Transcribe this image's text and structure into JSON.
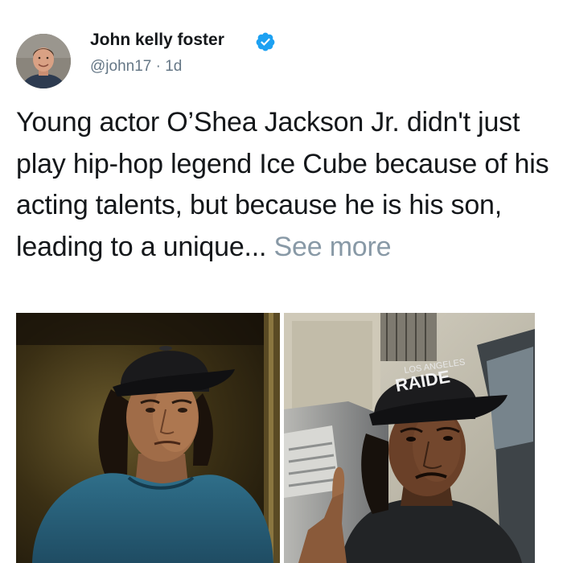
{
  "tweet": {
    "author": {
      "name": "John kelly foster",
      "handle": "@john17",
      "separator": "·",
      "timestamp": "1d",
      "verified": true,
      "avatar_icon": "profile-photo"
    },
    "text": "Young actor O’Shea Jackson Jr. didn't just play hip-hop legend Ice Cube because of his acting talents, but because he is his son, leading to a unique...",
    "see_more_label": "See more",
    "media": {
      "left_image": "photo-of-young-actor-in-black-cap-and-blue-shirt",
      "right_image": "photo-of-ice-cube-in-raiders-cap",
      "cap_text": "RAIDE"
    },
    "colors": {
      "verified_badge": "#1da1f2",
      "text": "#14171a",
      "secondary_text": "#657786",
      "see_more": "#8899a6"
    }
  }
}
